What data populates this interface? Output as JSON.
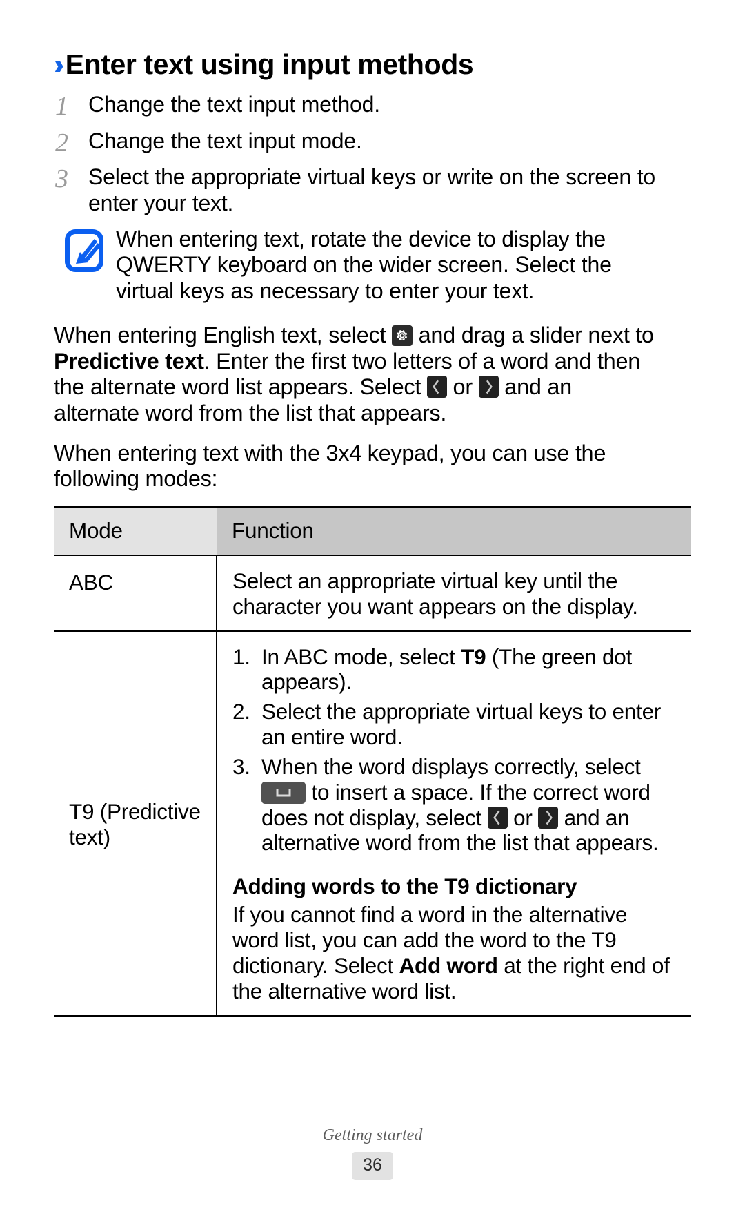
{
  "heading": {
    "chevron": "››",
    "title": "Enter text using input methods",
    "accent_color": "#1464e6"
  },
  "steps": [
    {
      "num": "1",
      "text": "Change the text input method."
    },
    {
      "num": "2",
      "text": "Change the text input mode."
    },
    {
      "num": "3",
      "text": "Select the appropriate virtual keys or write on the screen to enter your text."
    }
  ],
  "note": {
    "icon": "note-pen-icon",
    "text": "When entering text, rotate the device to display the QWERTY keyboard on the wider screen. Select the virtual keys as necessary to enter your text."
  },
  "paragraphs": {
    "english_text": {
      "part1": "When entering English text, select ",
      "icon1": "settings-gear-icon",
      "part2": " and drag a slider next to ",
      "bold1": "Predictive text",
      "part3": ". Enter the first two letters of a word and then the alternate word list appears. Select ",
      "icon2": "arrow-left-icon",
      "part4": " or ",
      "icon3": "arrow-right-icon",
      "part5": " and an alternate word from the list that appears."
    },
    "keypad_intro": "When entering text with the 3x4 keypad, you can use the following modes:"
  },
  "table": {
    "headers": {
      "mode": "Mode",
      "function": "Function"
    },
    "header_bg_mode": "#e3e3e3",
    "header_bg_function": "#c6c6c6",
    "rows": [
      {
        "mode": "ABC",
        "function_text": "Select an appropriate virtual key until the character you want appears on the display."
      },
      {
        "mode": "T9 (Predictive text)",
        "ordered_items": [
          {
            "num": "1.",
            "part1": "In ABC mode, select ",
            "bold": "T9",
            "part2": " (The green dot appears)."
          },
          {
            "num": "2.",
            "part1": "Select the appropriate virtual keys to enter an entire word.",
            "bold": "",
            "part2": ""
          },
          {
            "num": "3.",
            "part1": "When the word displays correctly, select ",
            "icon1": "space-key-icon",
            "part2": " to insert a space. If the correct word does not display, select ",
            "icon2": "arrow-left-icon",
            "part3": " or ",
            "icon3": "arrow-right-icon",
            "part4": " and an alternative word from the list that appears."
          }
        ],
        "sub_heading": "Adding words to the T9 dictionary",
        "sub_part1": "If you cannot find a word in the alternative word list, you can add the word to the T9 dictionary. Select ",
        "sub_bold": "Add word",
        "sub_part2": " at the right end of the alternative word list."
      }
    ]
  },
  "footer": {
    "section": "Getting started",
    "page_number": "36"
  }
}
